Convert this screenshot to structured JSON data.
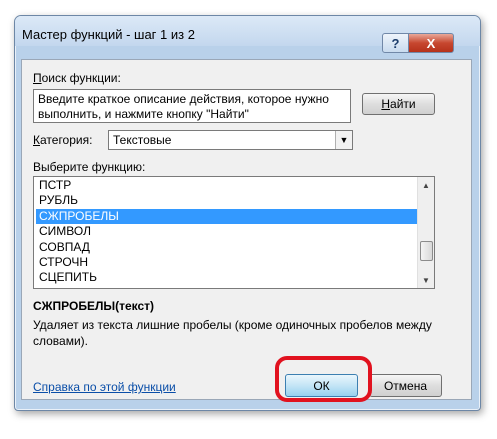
{
  "window": {
    "title": "Мастер функций - шаг 1 из 2",
    "help_glyph": "?",
    "close_glyph": "X"
  },
  "search": {
    "label_prefix": "П",
    "label_rest": "оиск функции:",
    "text": "Введите краткое описание действия, которое нужно выполнить, и нажмите кнопку \"Найти\"",
    "find_prefix": "Н",
    "find_rest": "айти"
  },
  "category": {
    "label_prefix": "К",
    "label_rest": "атегория:",
    "value": "Текстовые"
  },
  "functions": {
    "label": "Выберите функцию:",
    "items": [
      "ПСТР",
      "РУБЛЬ",
      "СЖПРОБЕЛЫ",
      "СИМВОЛ",
      "СОВПАД",
      "СТРОЧН",
      "СЦЕПИТЬ"
    ],
    "selected_index": 2,
    "scroll_position": 0.82
  },
  "details": {
    "signature": "СЖПРОБЕЛЫ(текст)",
    "description": "Удаляет из текста лишние пробелы (кроме одиночных пробелов между словами)."
  },
  "footer": {
    "help_link": "Справка по этой функции",
    "ok_label": "ОК",
    "cancel_label": "Отмена"
  },
  "colors": {
    "highlight": "#e1121f",
    "selection": "#3399ff",
    "link": "#0a4ea8"
  }
}
